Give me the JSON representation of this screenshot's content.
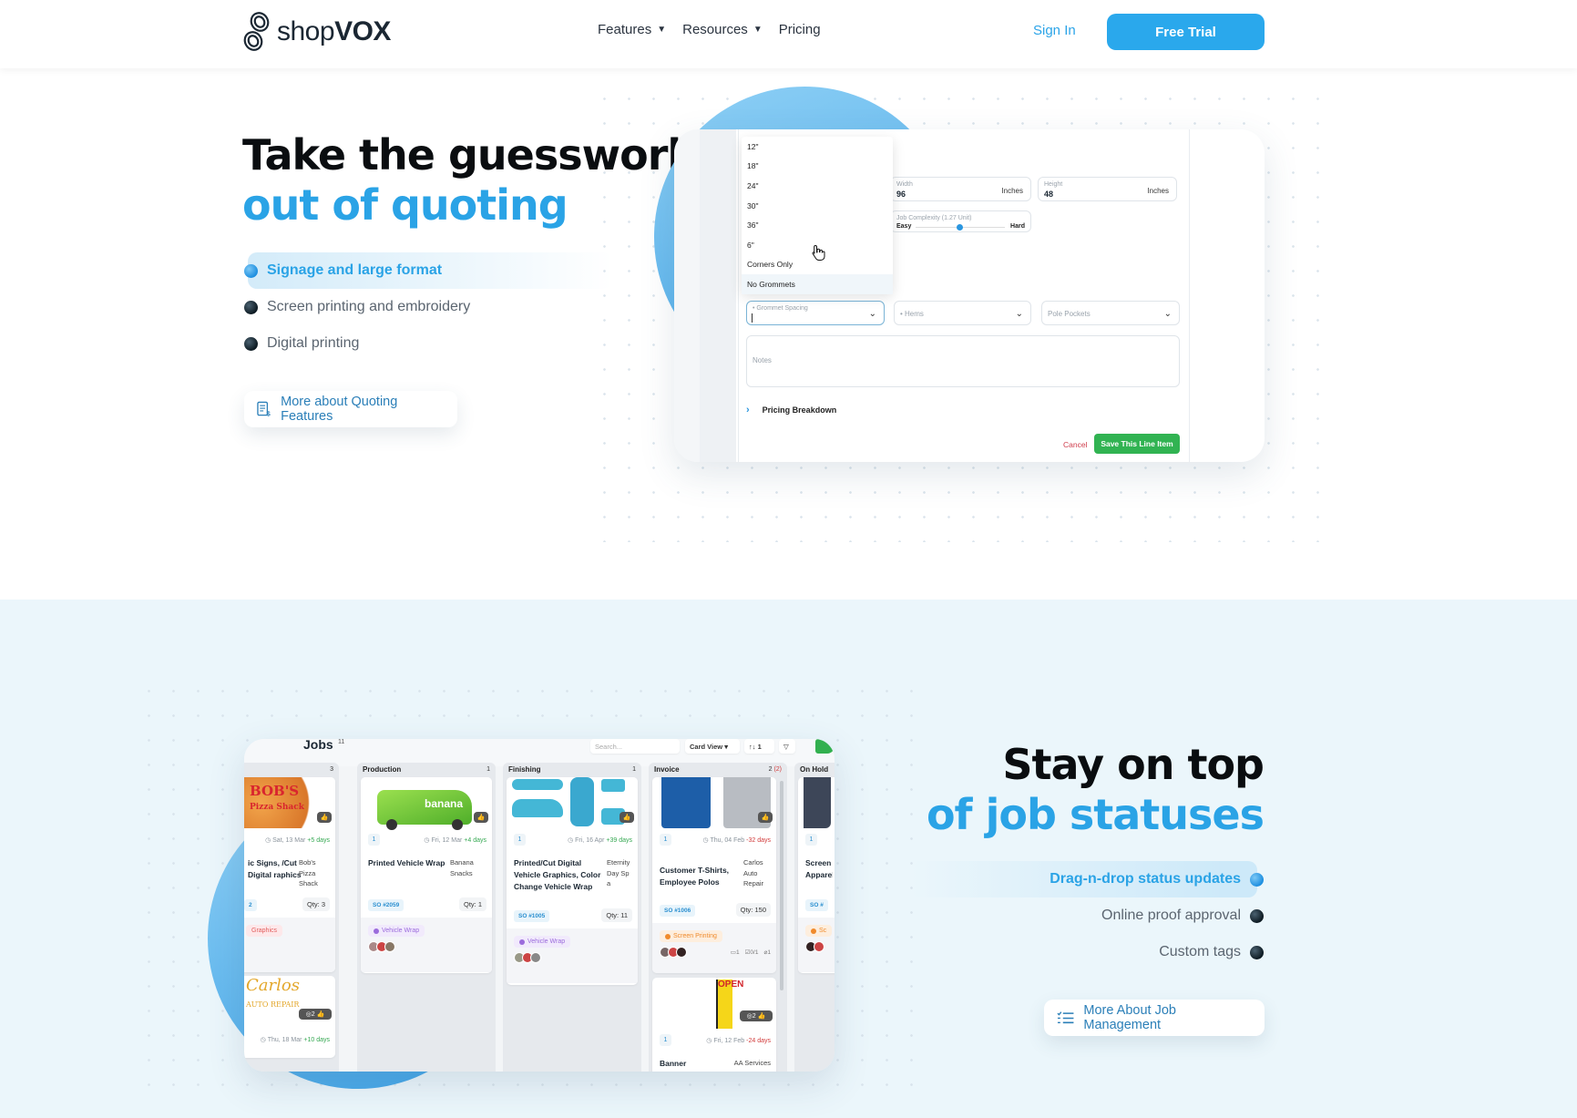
{
  "nav": {
    "brand_light": "shop",
    "brand_bold": "VOX",
    "links": [
      {
        "label": "Features",
        "has_caret": true
      },
      {
        "label": "Resources",
        "has_caret": true
      },
      {
        "label": "Pricing",
        "has_caret": false
      }
    ],
    "caret": "▼",
    "sign_in": "Sign In",
    "free_trial": "Free Trial"
  },
  "quoting": {
    "title_line1": "Take the guesswork",
    "title_line2": "out of quoting",
    "features": [
      {
        "label": "Signage and large format",
        "active": true
      },
      {
        "label": "Screen printing and embroidery",
        "active": false
      },
      {
        "label": "Digital printing",
        "active": false
      }
    ],
    "cta": "More about Quoting Features",
    "form": {
      "dropdown_options": [
        "12\"",
        "18\"",
        "24\"",
        "30\"",
        "36\"",
        "6\"",
        "Corners Only",
        "No Grommets"
      ],
      "width_label": "Width",
      "width_value": "96",
      "width_unit": "Inches",
      "height_label": "Height",
      "height_value": "48",
      "height_unit": "Inches",
      "complexity_label": "Job Complexity (1.27 Unit)",
      "complexity_easy": "Easy",
      "complexity_hard": "Hard",
      "complexity_level_percent": 45,
      "grommet_label": "• Grommet Spacing",
      "hems_label": "• Hems",
      "pole_pockets_label": "Pole Pockets",
      "notes_placeholder": "Notes",
      "pricing_breakdown": "Pricing Breakdown",
      "cancel": "Cancel",
      "save": "Save This Line Item"
    }
  },
  "jobs": {
    "title_line1": "Stay on top",
    "title_line2": "of job statuses",
    "features": [
      {
        "label": "Drag-n-drop status updates",
        "active": true
      },
      {
        "label": "Online proof approval",
        "active": false
      },
      {
        "label": "Custom tags",
        "active": false
      }
    ],
    "cta": "More About Job Management",
    "board": {
      "title": "Jobs",
      "count": "11",
      "search_placeholder": "Search...",
      "view": "Card View ▾",
      "sort": "↑↓ 1",
      "filter_icon": "▽",
      "columns": [
        {
          "name": "",
          "count": "3",
          "cards": [
            {
              "num": "",
              "date": "Sat, 13 Mar",
              "delta": "+5 days",
              "delta_type": "g",
              "title": "ic Signs, /Cut Digital raphics",
              "customer": "Bob's Pizza Shack",
              "so": "2",
              "qty": "Qty: 3",
              "tag": "Graphics",
              "tag_color": "#e35d5d",
              "image_text": "BOB'S Pizza Shack"
            },
            {
              "date": "Thu, 18 Mar",
              "delta": "+10 days",
              "delta_type": "g",
              "image_text": "Carlos AUTO REPAIR",
              "views": "2"
            }
          ]
        },
        {
          "name": "Production",
          "count": "1",
          "cards": [
            {
              "num": "1",
              "date": "Fri, 12 Mar",
              "delta": "+4 days",
              "delta_type": "g",
              "title": "Printed Vehicle Wrap",
              "customer": "Banana Snacks",
              "so": "SO #2059",
              "qty": "Qty: 1",
              "tag": "Vehicle Wrap",
              "tag_color": "#9b6bdc",
              "image_text": "banana"
            }
          ]
        },
        {
          "name": "Finishing",
          "count": "1",
          "cards": [
            {
              "num": "1",
              "date": "Fri, 16 Apr",
              "delta": "+39 days",
              "delta_type": "g",
              "title": "Printed/Cut Digital Vehicle Graphics, Color Change Vehicle Wrap",
              "customer": "Eternity Day Spa",
              "so": "SO #1005",
              "qty": "Qty: 11",
              "tag": "Vehicle Wrap",
              "tag_color": "#9b6bdc"
            }
          ]
        },
        {
          "name": "Invoice",
          "count": "2",
          "count_extra": "(2)",
          "cards": [
            {
              "num": "1",
              "date": "Thu, 04 Feb",
              "delta": "-32 days",
              "delta_type": "r",
              "title": "Customer T-Shirts, Employee Polos",
              "customer": "Carlos Auto Repair",
              "so": "SO #1006",
              "qty": "Qty: 150",
              "tag": "Screen Printing",
              "tag_color": "#f08a2b",
              "comments": "1",
              "tasks": "0/1",
              "attachments": "1"
            },
            {
              "num": "1",
              "date": "Fri, 12 Feb",
              "delta": "-24 days",
              "delta_type": "r",
              "title": "Banner",
              "customer": "AA Services",
              "image_text": "OPEN",
              "views": "2"
            }
          ]
        },
        {
          "name": "On Hold",
          "count": "",
          "cards": [
            {
              "num": "1",
              "title": "Screen Apparel",
              "so": "SO #",
              "tag": "Sc",
              "tag_color": "#f08a2b"
            }
          ]
        }
      ]
    }
  }
}
